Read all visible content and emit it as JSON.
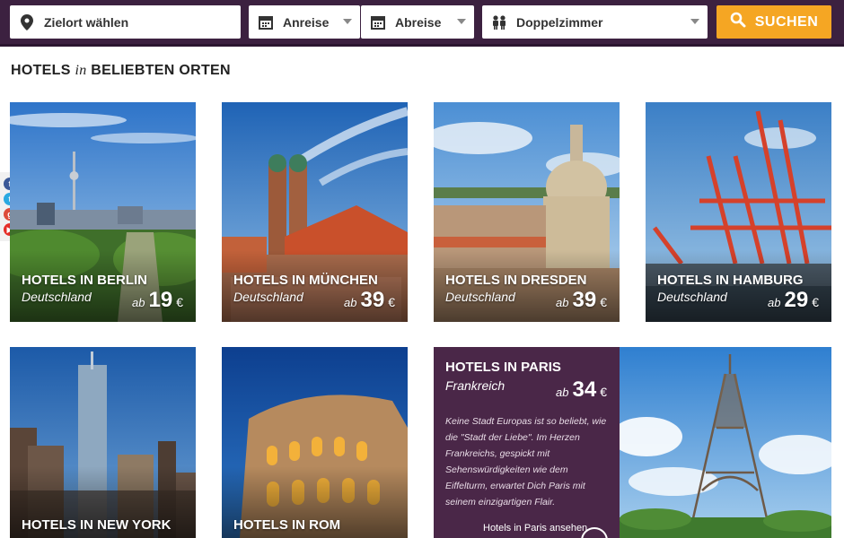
{
  "search": {
    "destination_placeholder": "Zielort wählen",
    "arrival_label": "Anreise",
    "departure_label": "Abreise",
    "room_label": "Doppelzimmer",
    "search_button": "SUCHEN"
  },
  "section": {
    "title_pre": "HOTELS",
    "title_in": "in",
    "title_post": "BELIEBTEN ORTEN"
  },
  "currency": "€",
  "price_prefix": "ab",
  "tiles": [
    {
      "title": "HOTELS IN BERLIN",
      "country": "Deutschland",
      "price": "19"
    },
    {
      "title": "HOTELS IN MÜNCHEN",
      "country": "Deutschland",
      "price": "39"
    },
    {
      "title": "HOTELS IN DRESDEN",
      "country": "Deutschland",
      "price": "39"
    },
    {
      "title": "HOTELS IN HAMBURG",
      "country": "Deutschland",
      "price": "29"
    },
    {
      "title": "HOTELS IN NEW YORK"
    },
    {
      "title": "HOTELS IN ROM"
    }
  ],
  "feature": {
    "title": "HOTELS IN PARIS",
    "country": "Frankreich",
    "price": "34",
    "description": "Keine Stadt Europas ist so beliebt, wie die \"Stadt der Liebe\". Im Herzen Frankreichs, gespickt mit Sehenswürdigkeiten wie dem Eiffelturm, erwartet Dich Paris mit seinem einzigartigen Flair.",
    "link_text": "Hotels in Paris ansehen"
  },
  "social": [
    {
      "name": "facebook",
      "glyph": "f",
      "color": "#3b5998"
    },
    {
      "name": "twitter",
      "glyph": "t",
      "color": "#29a9e1"
    },
    {
      "name": "google-plus",
      "glyph": "g",
      "color": "#dd4b39"
    },
    {
      "name": "youtube",
      "glyph": "▶",
      "color": "#e52d27"
    }
  ],
  "colors": {
    "header_bg": "#3c2140",
    "accent": "#f5a623",
    "feature_panel": "#4a2748"
  }
}
